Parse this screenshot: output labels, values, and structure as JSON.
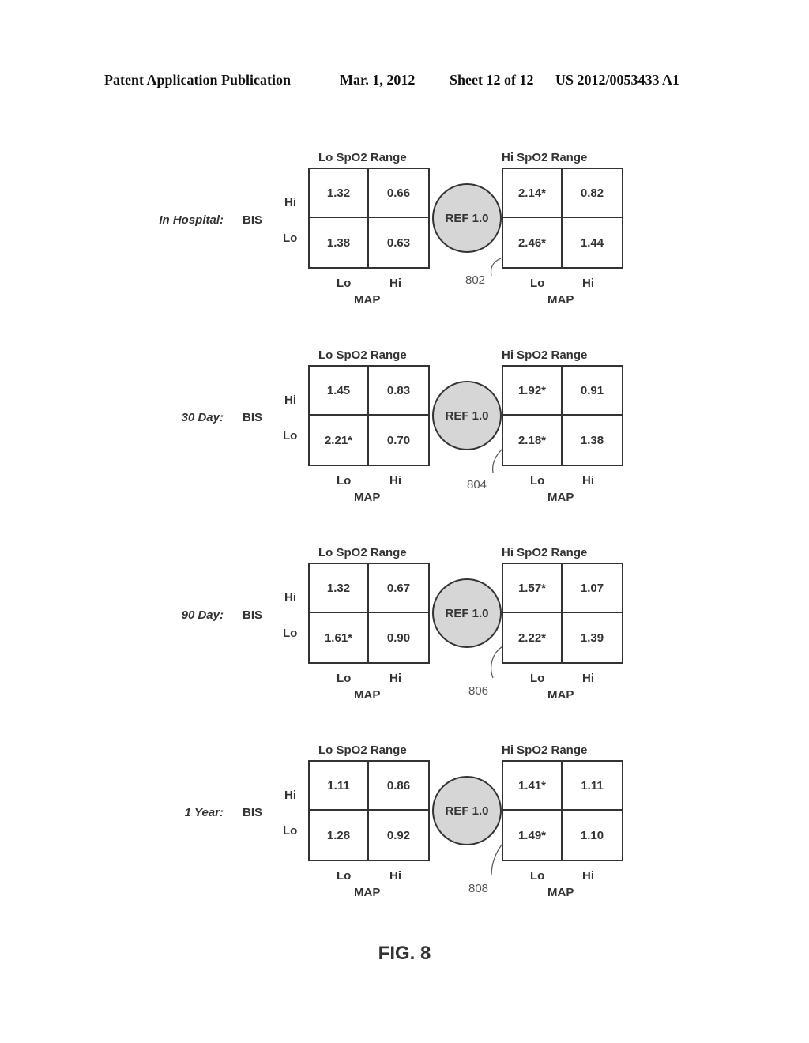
{
  "header": {
    "publication": "Patent Application Publication",
    "date": "Mar. 1, 2012",
    "sheet": "Sheet 12 of 12",
    "number": "US 2012/0053433 A1"
  },
  "labels": {
    "lo_range": "Lo SpO2 Range",
    "hi_range": "Hi SpO2 Range",
    "row_var": "BIS",
    "col_var": "MAP",
    "hi": "Hi",
    "lo": "Lo",
    "ref": "REF 1.0"
  },
  "panels": [
    {
      "period": "In Hospital:",
      "ref_num": "802",
      "lo_spo2": {
        "hi_lo": "1.32",
        "hi_hi": "0.66",
        "lo_lo": "1.38",
        "lo_hi": "0.63"
      },
      "hi_spo2": {
        "hi_lo": "2.14*",
        "hi_hi": "0.82",
        "lo_lo": "2.46*",
        "lo_hi": "1.44"
      }
    },
    {
      "period": "30 Day:",
      "ref_num": "804",
      "lo_spo2": {
        "hi_lo": "1.45",
        "hi_hi": "0.83",
        "lo_lo": "2.21*",
        "lo_hi": "0.70"
      },
      "hi_spo2": {
        "hi_lo": "1.92*",
        "hi_hi": "0.91",
        "lo_lo": "2.18*",
        "lo_hi": "1.38"
      }
    },
    {
      "period": "90 Day:",
      "ref_num": "806",
      "lo_spo2": {
        "hi_lo": "1.32",
        "hi_hi": "0.67",
        "lo_lo": "1.61*",
        "lo_hi": "0.90"
      },
      "hi_spo2": {
        "hi_lo": "1.57*",
        "hi_hi": "1.07",
        "lo_lo": "2.22*",
        "lo_hi": "1.39"
      }
    },
    {
      "period": "1 Year:",
      "ref_num": "808",
      "lo_spo2": {
        "hi_lo": "1.11",
        "hi_hi": "0.86",
        "lo_lo": "1.28",
        "lo_hi": "0.92"
      },
      "hi_spo2": {
        "hi_lo": "1.41*",
        "hi_hi": "1.11",
        "lo_lo": "1.49*",
        "lo_hi": "1.10"
      }
    }
  ],
  "figure_label": "FIG. 8"
}
